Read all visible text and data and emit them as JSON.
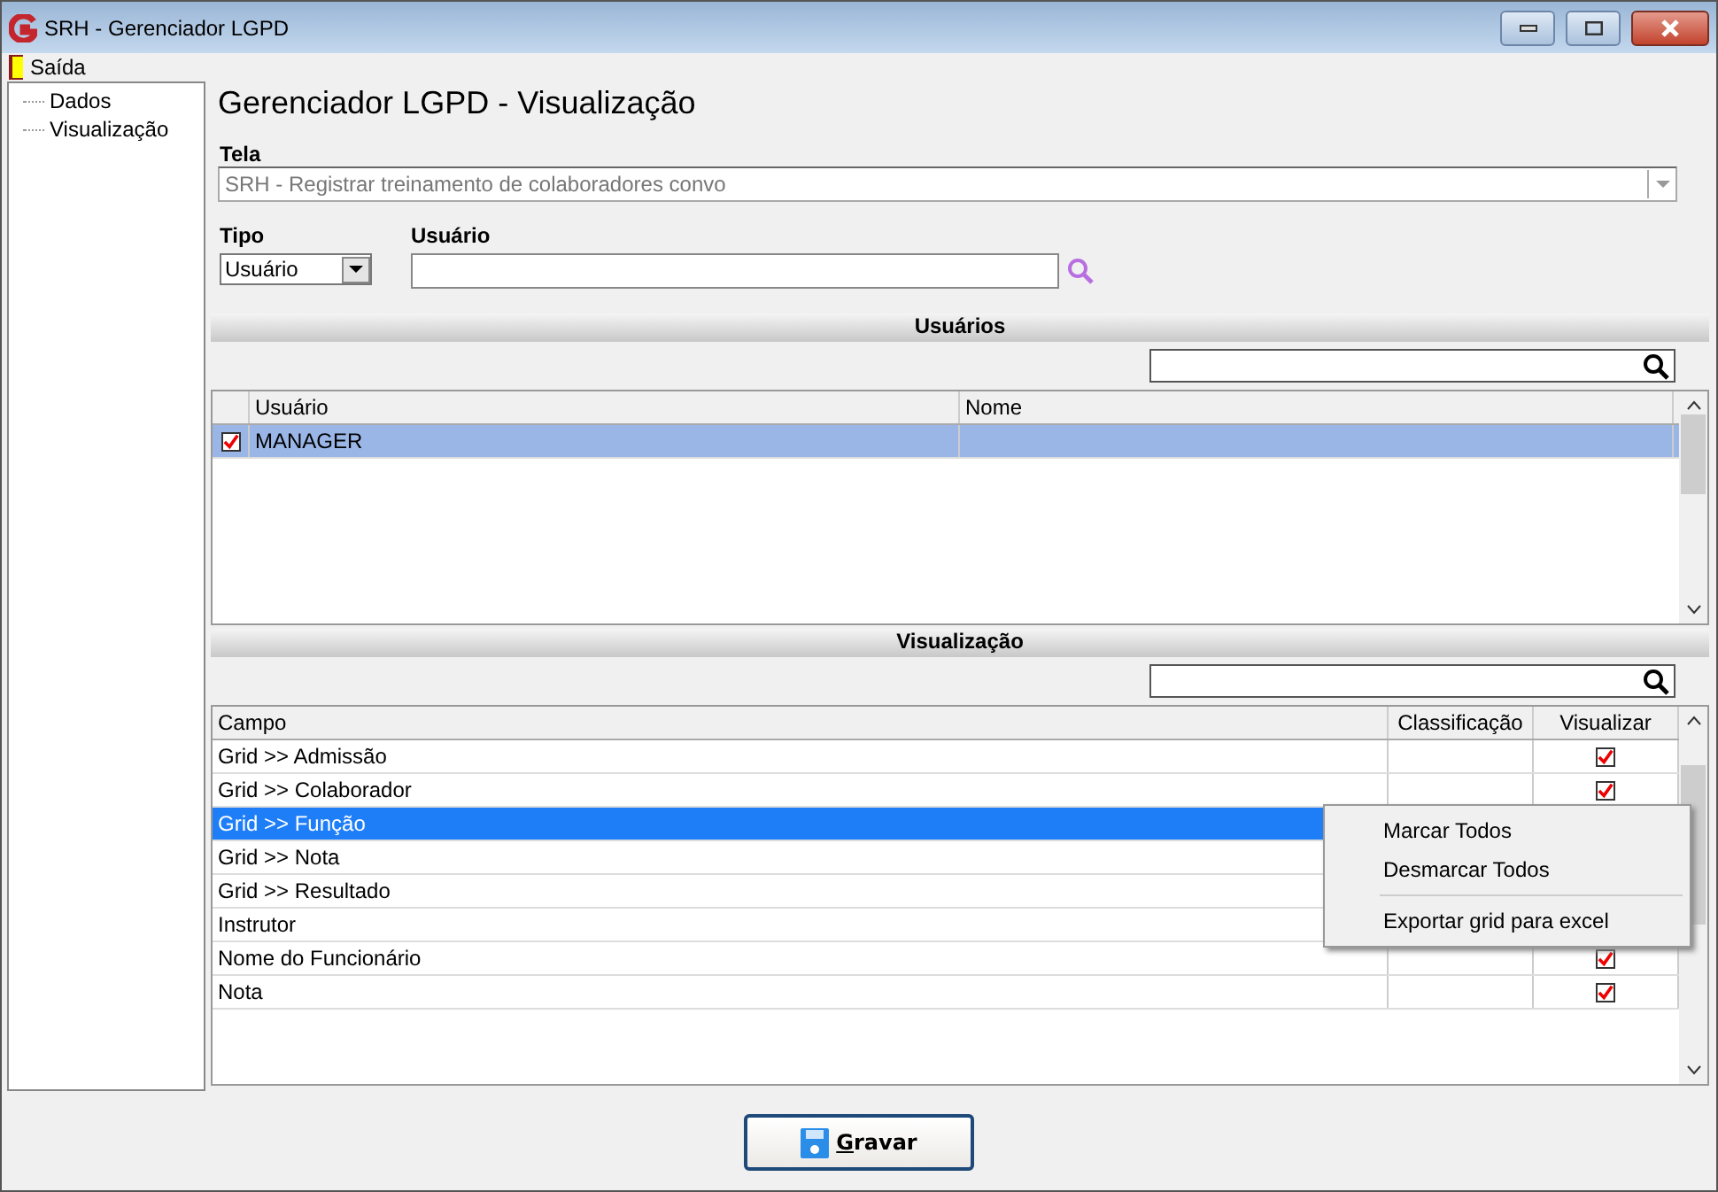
{
  "window": {
    "title": "SRH - Gerenciador LGPD"
  },
  "menu": [
    {
      "label": "Saída"
    }
  ],
  "tree": [
    {
      "label": "Dados"
    },
    {
      "label": "Visualização"
    }
  ],
  "heading": "Gerenciador LGPD - Visualização",
  "tela": {
    "label": "Tela",
    "value": "SRH - Registrar treinamento de colaboradores convo",
    "disabled": true
  },
  "tipo": {
    "label": "Tipo",
    "value": "Usuário"
  },
  "usuario": {
    "label": "Usuário"
  },
  "usuarios": {
    "title": "Usuários",
    "columns": [
      "Usuário",
      "Nome"
    ],
    "rows": [
      {
        "usuario": "MANAGER",
        "checked": true,
        "selected": true
      }
    ]
  },
  "visualizacao": {
    "title": "Visualização",
    "columns": [
      "Campo",
      "Classificação",
      "Visualizar"
    ],
    "rows": [
      {
        "campo": "Grid >> Admissão",
        "checked": true,
        "selected": false
      },
      {
        "campo": "Grid >> Colaborador",
        "checked": true,
        "selected": false
      },
      {
        "campo": "Grid >> Função",
        "selected": true
      },
      {
        "campo": "Grid >> Nota",
        "selected": false
      },
      {
        "campo": "Grid >> Resultado",
        "selected": false
      },
      {
        "campo": "Instrutor",
        "selected": false
      },
      {
        "campo": "Nome do Funcionário",
        "checked": true,
        "selected": false
      },
      {
        "campo": "Nota",
        "checked": true,
        "selected": false
      }
    ]
  },
  "context_menu": [
    {
      "label": "Marcar Todos",
      "kind": "item"
    },
    {
      "label": "Desmarcar Todos",
      "kind": "item"
    },
    {
      "kind": "separator"
    },
    {
      "label": "Exportar grid para excel",
      "kind": "item"
    }
  ],
  "save_button": "Gravar"
}
